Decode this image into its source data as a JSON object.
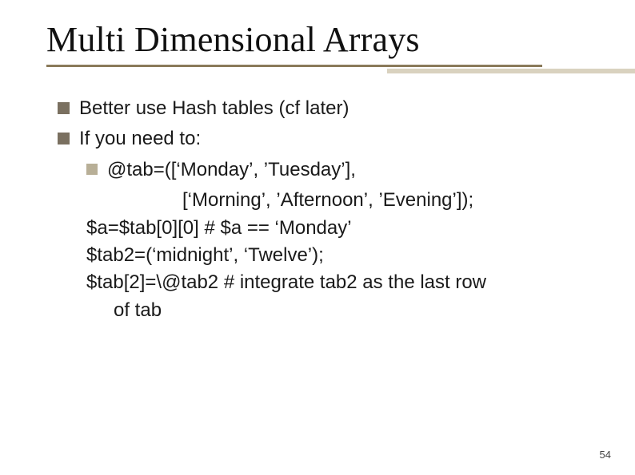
{
  "title": "Multi Dimensional Arrays",
  "bullets": {
    "b1": "Better use Hash tables (cf later)",
    "b2": "If you need to:",
    "sub1_line1": "@tab=([‘Monday’, ’Tuesday’],",
    "sub1_line2": "[‘Morning’, ’Afternoon’, ’Evening’]);",
    "code1": "$a=$tab[0][0] # $a == ‘Monday’",
    "code2": "$tab2=(‘midnight’,  ‘Twelve’);",
    "code3_a": "$tab[2]=\\@tab2 # integrate tab2 as the last row",
    "code3_b": "of tab"
  },
  "page_number": "54"
}
